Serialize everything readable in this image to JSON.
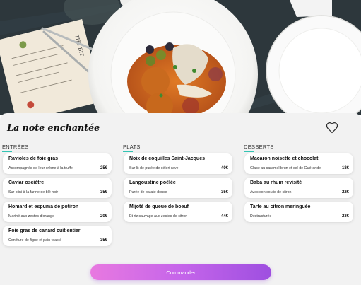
{
  "restaurant": {
    "name": "La note enchantée"
  },
  "icons": {
    "favorite": "heart-outline-icon"
  },
  "colors": {
    "accent": "#34c4b4",
    "cta_start": "#e879e0",
    "cta_end": "#9e4fe0",
    "panel": "#f2f2f2"
  },
  "menu_paper": {
    "title": "THE BIT"
  },
  "sections": {
    "starters": {
      "title": "ENTRÉES",
      "items": [
        {
          "name": "Ravioles de foie gras",
          "desc": "Accompagnés de leur crème à la truffe",
          "price": "25€"
        },
        {
          "name": "Caviar osciètre",
          "desc": "Sur blini à la farine de blé noir",
          "price": "35€"
        },
        {
          "name": "Homard et espuma de potiron",
          "desc": "Mariné aux zestes d'orange",
          "price": "20€"
        },
        {
          "name": "Foie gras de canard cuit entier",
          "desc": "Confiture de figue et pain toasté",
          "price": "35€"
        }
      ]
    },
    "mains": {
      "title": "PLATS",
      "items": [
        {
          "name": "Noix de coquilles Saint-Jacques",
          "desc": "Sur lit de purée de céleri-rave",
          "price": "40€"
        },
        {
          "name": "Langoustine poêlée",
          "desc": "Purée de patate douce",
          "price": "35€"
        },
        {
          "name": "Mijoté de queue de boeuf",
          "desc": "Et riz sauvage aux zestes de citron",
          "price": "44€"
        }
      ]
    },
    "desserts": {
      "title": "DESSERTS",
      "items": [
        {
          "name": "Macaron noisette et chocolat",
          "desc": "Glace au caramel brun et sel de Guérande",
          "price": "18€"
        },
        {
          "name": "Baba au rhum revisité",
          "desc": "Avec son coulis de citron",
          "price": "22€"
        },
        {
          "name": "Tarte au citron meringuée",
          "desc": "Déstructurée",
          "price": "23€"
        }
      ]
    }
  },
  "actions": {
    "order_label": "Commander"
  }
}
